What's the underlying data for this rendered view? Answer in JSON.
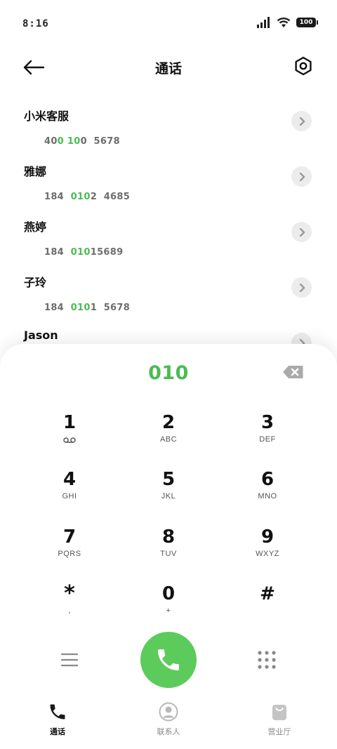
{
  "status_bar": {
    "time": "8:16",
    "battery": "100"
  },
  "header": {
    "title": "通话"
  },
  "contacts": [
    {
      "name": "小米客服",
      "number_parts": [
        {
          "t": "40",
          "hl": false
        },
        {
          "t": "0",
          "hl": true
        },
        {
          "t": " ",
          "hl": false
        },
        {
          "t": "10",
          "hl": true
        },
        {
          "t": "0  5678",
          "hl": false
        }
      ]
    },
    {
      "name": "雅娜",
      "number_parts": [
        {
          "t": "184  ",
          "hl": false
        },
        {
          "t": "010",
          "hl": true
        },
        {
          "t": "2  4685",
          "hl": false
        }
      ]
    },
    {
      "name": "燕婷",
      "number_parts": [
        {
          "t": "184  ",
          "hl": false
        },
        {
          "t": "010",
          "hl": true
        },
        {
          "t": "15689",
          "hl": false
        }
      ]
    },
    {
      "name": "子玲",
      "number_parts": [
        {
          "t": "184  ",
          "hl": false
        },
        {
          "t": "010",
          "hl": true
        },
        {
          "t": "1  5678",
          "hl": false
        }
      ]
    },
    {
      "name": "Jason",
      "number_parts": []
    }
  ],
  "dialpad": {
    "dialed": "010",
    "keys": [
      {
        "digit": "1",
        "letters": "voicemail-icon"
      },
      {
        "digit": "2",
        "letters": "ABC"
      },
      {
        "digit": "3",
        "letters": "DEF"
      },
      {
        "digit": "4",
        "letters": "GHI"
      },
      {
        "digit": "5",
        "letters": "JKL"
      },
      {
        "digit": "6",
        "letters": "MNO"
      },
      {
        "digit": "7",
        "letters": "PQRS"
      },
      {
        "digit": "8",
        "letters": "TUV"
      },
      {
        "digit": "9",
        "letters": "WXYZ"
      },
      {
        "digit": "*",
        "letters": ","
      },
      {
        "digit": "0",
        "letters": "+"
      },
      {
        "digit": "#",
        "letters": ""
      }
    ]
  },
  "nav": {
    "items": [
      {
        "label": "通话",
        "icon": "phone-icon",
        "active": true
      },
      {
        "label": "联系人",
        "icon": "person-icon",
        "active": false
      },
      {
        "label": "营业厅",
        "icon": "bag-icon",
        "active": false
      }
    ]
  },
  "colors": {
    "accent_green": "#4cbb52",
    "call_button": "#5ccb5b"
  }
}
